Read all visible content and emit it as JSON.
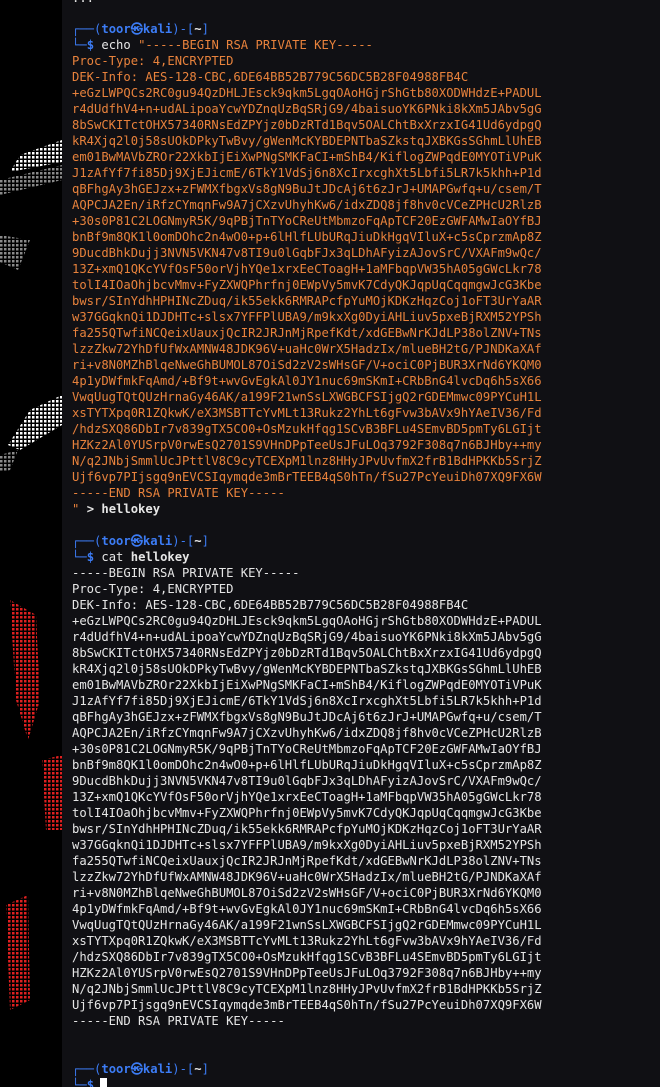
{
  "terminal": {
    "prompt": {
      "user_host": "toor㉿kali",
      "path": "~"
    },
    "block1": {
      "top_fragment": "...",
      "command": "echo",
      "begin": "\"-----BEGIN RSA PRIVATE KEY-----",
      "end_quote": "\"",
      "redirect": ">",
      "target": "hellokey"
    },
    "block2": {
      "command": "cat",
      "arg": "hellokey"
    },
    "key": {
      "begin": "-----BEGIN RSA PRIVATE KEY-----",
      "proc_type": "Proc-Type: 4,ENCRYPTED",
      "dek_info": "DEK-Info: AES-128-CBC,6DE64BB52B779C56DC5B28F04988FB4C",
      "end": "-----END RSA PRIVATE KEY-----",
      "lines": [
        "+eGzLWPQCs2RC0gu94QzDHLJEsck9qkm5LgqOAoHGjrShGtb80XODWHdzE+PADUL",
        "r4dUdfhV4+n+udALipoaYcwYDZnqUzBqSRjG9/4baisuoYK6PNki8kXm5JAbv5gG",
        "8bSwCKITctOHX57340RNsEdZPYjz0bDzRTd1Bqv5OALChtBxXrzxIG41Ud6ydpgQ",
        "kR4Xjq2l0j58sUOkDPkyTwBvy/gWenMcKYBDEPNTbaSZkstqJXBKGsSGhmLlUhEB",
        "em01BwMAVbZROr22XkbIjEiXwPNgSMKFaCI+mShB4/KiflogZWPqdE0MYOTiVPuK",
        "J1zAfYf7fi85Dj9XjEJicmE/6TkY1VdSj6n8XcIrxcghXt5Lbfi5LR7k5khh+P1d",
        "qBFhgAy3hGEJzx+zFWMXfbgxVs8gN9BuJtJDcAj6t6zJrJ+UMAPGwfq+u/csem/T",
        "AQPCJA2En/iRfzCYmqnFw9A7jCXzvUhyhKw6/idxZDQ8jf8hv0cVCeZPHcU2RlzB",
        "+30s0P81C2LOGNmyR5K/9qPBjTnTYoCReUtMbmzoFqApTCF20EzGWFAMwIaOYfBJ",
        "bnBf9m8QK1l0omDOhc2n4wO0+p+6lHlfLUbURqJiuDkHgqVIluX+c5sCprzmAp8Z",
        "9DucdBhkDujj3NVN5VKN47v8TI9u0lGqbFJx3qLDhAFyizAJovSrC/VXAFm9wQc/",
        "13Z+xmQ1QKcYVfOsF50orVjhYQe1xrxEeCToagH+1aMFbqpVW35hA05gGWcLkr78",
        "tolI4IOaOhjbcvMmv+FyZXWQPhrfnj0EWpVy5mvK7CdyQKJqpUqCqqmgwJcG3Kbe",
        "bwsr/SInYdhHPHINcZDuq/ik55ekk6RMRAPcfpYuMOjKDKzHqzCoj1oFT3UrYaAR",
        "w37GGqknQi1DJDHTc+slsx7YFFPlUBA9/m9kxXg0DyiAHLiuv5pxeBjRXM52YPSh",
        "fa255QTwfiNCQeixUauxjQcIR2JRJnMjRpefKdt/xdGEBwNrKJdLP38olZNV+TNs",
        "lzzZkw72YhDfUfWxAMNW48JDK96V+uaHc0WrX5HadzIx/mlueBH2tG/PJNDKaXAf",
        "ri+v8N0MZhBlqeNweGhBUMOL87OiSd2zV2sWHsGF/V+ociC0PjBUR3XrNd6YKQM0",
        "4p1yDWfmkFqAmd/+Bf9t+wvGvEgkAl0JY1nuc69mSKmI+CRbBnG4lvcDq6h5sX66",
        "VwqUugTQtQUzHrnaGy46AK/a199F21wnSsLXWGBCFSIjgQ2rGDEMmwc09PYCuH1L",
        "xsTYTXpq0R1ZQkwK/eX3MSBTTcYvMLt13Rukz2YhLt6gFvw3bAVx9hYAeIV36/Fd",
        "/hdzSXQ86DbIr7v839gTX5CO0+OsMzukHfqg1SCvB3BFLu4SEmvBD5pmTy6LGIjt",
        "HZKz2Al0YUSrpV0rwEsQ2701S9VHnDPpTeeUsJFuLOq3792F308q7n6BJHby++my",
        "N/q2JNbjSmmlUcJPttlV8C9cyTCEXpM1lnz8HHyJPvUvfmX2frB1BdHPKKb5SrjZ",
        "Ujf6vp7PIjsgq9nEVCSIqymqde3mBrTEEB4qS0hTn/fSu27PcYeuiDh07XQ9FX6W"
      ]
    }
  }
}
